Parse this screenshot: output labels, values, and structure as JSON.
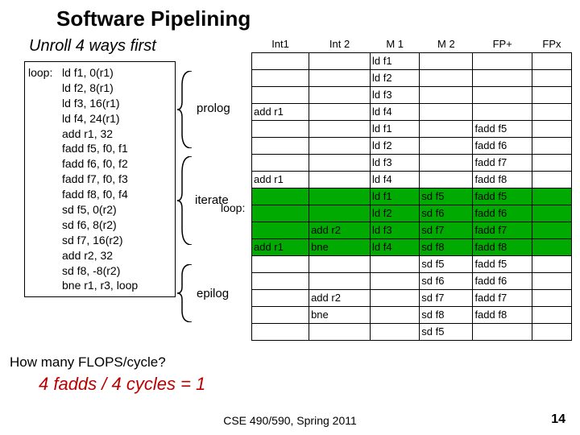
{
  "title": "Software Pipelining",
  "subtitle": "Unroll 4 ways first",
  "loop_label": "loop:",
  "loop_lines": [
    "ld f1, 0(r1)",
    "ld f2, 8(r1)",
    "ld f3, 16(r1)",
    "ld f4, 24(r1)",
    "add r1, 32",
    "fadd f5, f0, f1",
    "fadd f6, f0, f2",
    "fadd f7, f0, f3",
    "fadd f8, f0, f4",
    "sd f5, 0(r2)",
    "sd f6, 8(r2)",
    "sd f7, 16(r2)",
    "add r2, 32",
    "sd f8, -8(r2)",
    "bne r1, r3, loop"
  ],
  "brace_labels": {
    "prolog": "prolog",
    "iterate": "iterate",
    "epilog": "epilog"
  },
  "loop_side_label": "loop:",
  "headers": [
    "Int1",
    "Int 2",
    "M 1",
    "M 2",
    "FP+",
    "FPx"
  ],
  "rows": [
    {
      "cells": [
        "",
        "",
        "ld f1",
        "",
        "",
        ""
      ],
      "green": false
    },
    {
      "cells": [
        "",
        "",
        "ld f2",
        "",
        "",
        ""
      ],
      "green": false
    },
    {
      "cells": [
        "",
        "",
        "ld f3",
        "",
        "",
        ""
      ],
      "green": false
    },
    {
      "cells": [
        "add r1",
        "",
        "ld f4",
        "",
        "",
        ""
      ],
      "green": false
    },
    {
      "cells": [
        "",
        "",
        "ld f1",
        "",
        "fadd f5",
        ""
      ],
      "green": false
    },
    {
      "cells": [
        "",
        "",
        "ld f2",
        "",
        "fadd f6",
        ""
      ],
      "green": false
    },
    {
      "cells": [
        "",
        "",
        "ld f3",
        "",
        "fadd f7",
        ""
      ],
      "green": false
    },
    {
      "cells": [
        "add r1",
        "",
        "ld f4",
        "",
        "fadd f8",
        ""
      ],
      "green": false
    },
    {
      "cells": [
        "",
        "",
        "ld f1",
        "sd f5",
        "fadd f5",
        ""
      ],
      "green": true
    },
    {
      "cells": [
        "",
        "",
        "ld f2",
        "sd f6",
        "fadd f6",
        ""
      ],
      "green": true
    },
    {
      "cells": [
        "",
        "add r2",
        "ld f3",
        "sd f7",
        "fadd f7",
        ""
      ],
      "green": true
    },
    {
      "cells": [
        "add r1",
        "bne",
        "ld f4",
        "sd f8",
        "fadd f8",
        ""
      ],
      "green": true
    },
    {
      "cells": [
        "",
        "",
        "",
        "sd f5",
        "fadd f5",
        ""
      ],
      "green": false
    },
    {
      "cells": [
        "",
        "",
        "",
        "sd f6",
        "fadd f6",
        ""
      ],
      "green": false
    },
    {
      "cells": [
        "",
        "add r2",
        "",
        "sd f7",
        "fadd f7",
        ""
      ],
      "green": false
    },
    {
      "cells": [
        "",
        "bne",
        "",
        "sd f8",
        "fadd f8",
        ""
      ],
      "green": false
    },
    {
      "cells": [
        "",
        "",
        "",
        "sd f5",
        "",
        ""
      ],
      "green": false
    }
  ],
  "question": "How many FLOPS/cycle?",
  "answer": "4 fadds / 4 cycles = 1",
  "footer": "CSE 490/590, Spring 2011",
  "pagenum": "14"
}
